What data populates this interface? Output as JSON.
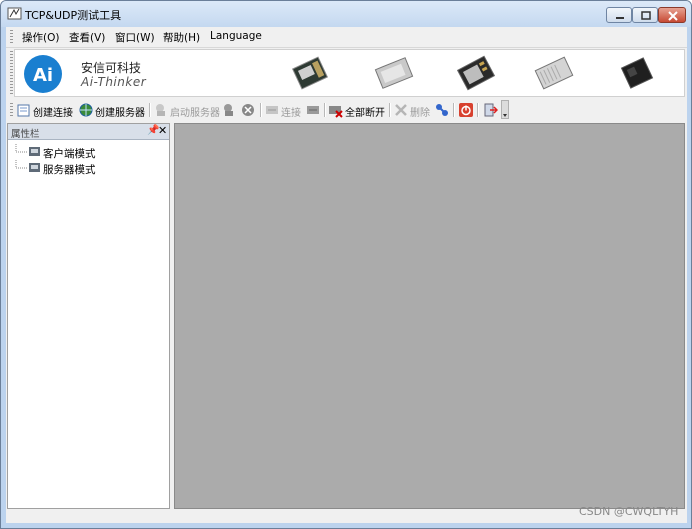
{
  "window": {
    "title": "TCP&UDP测试工具"
  },
  "menu": {
    "items": [
      {
        "label": "操作(O)"
      },
      {
        "label": "查看(V)"
      },
      {
        "label": "窗口(W)"
      },
      {
        "label": "帮助(H)"
      },
      {
        "label": "Language"
      }
    ]
  },
  "banner": {
    "logo_text": "Ai",
    "company_cn": "安信可科技",
    "company_en": "Ai-Thinker",
    "logo_color": "#1a7fd0"
  },
  "toolbar": {
    "create_connection": "创建连接",
    "create_server": "创建服务器",
    "start_server": "启动服务器",
    "connect": "连接",
    "disconnect_all": "全部断开",
    "delete": "删除"
  },
  "panel": {
    "title": "属性栏",
    "pin_glyph": "ᵽ",
    "close_glyph": "✕",
    "tree": [
      {
        "label": "客户端模式"
      },
      {
        "label": "服务器模式"
      }
    ]
  },
  "watermark": "CSDN @CWQLTYH",
  "colors": {
    "mdi_background": "#ababab",
    "panel_header": "#d8dfe9"
  }
}
